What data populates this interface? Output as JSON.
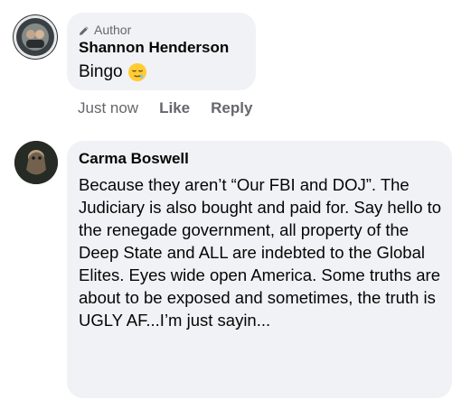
{
  "comments": [
    {
      "badge": "Author",
      "author": "Shannon Henderson",
      "text": "Bingo",
      "emoji": "sleepy-face-emoji",
      "actions": {
        "time": "Just now",
        "like": "Like",
        "reply": "Reply"
      }
    },
    {
      "author": "Carma Boswell",
      "text": "Because they aren’t “Our FBI and DOJ”. The Judiciary is also bought and paid for. Say hello to the renegade government, all property of the Deep State and ALL are indebted to the Global Elites. Eyes wide open America. Some truths are about to be exposed and sometimes, the truth is UGLY AF...I’m just sayin..."
    }
  ],
  "colors": {
    "bubble": "#f0f2f5",
    "muted_text": "#65676b",
    "primary_text": "#050505"
  }
}
